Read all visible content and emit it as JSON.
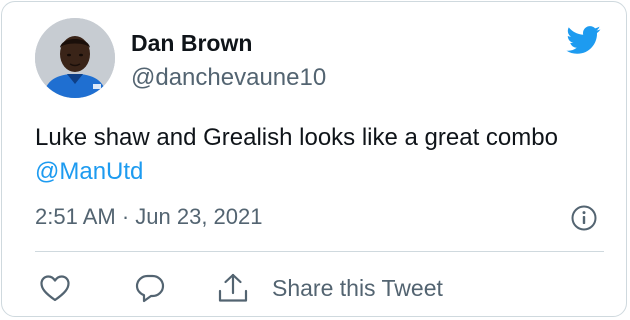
{
  "tweet": {
    "author": {
      "display_name": "Dan Brown",
      "handle": "@danchevaune10"
    },
    "text_before_mention": "Luke shaw and Grealish looks like a great combo ",
    "mention": "@ManUtd",
    "timestamp": "2:51 AM · Jun 23, 2021"
  },
  "actions": {
    "like_icon": "heart-icon",
    "reply_icon": "speech-bubble-icon",
    "share_icon": "share-upload-icon",
    "share_label": "Share this Tweet"
  },
  "icons": {
    "brand": "twitter-bird-icon",
    "info": "info-icon"
  },
  "colors": {
    "brand_blue": "#1d9bf0",
    "text_primary": "#0f1419",
    "text_secondary": "#536471",
    "border": "#cfd9de"
  }
}
